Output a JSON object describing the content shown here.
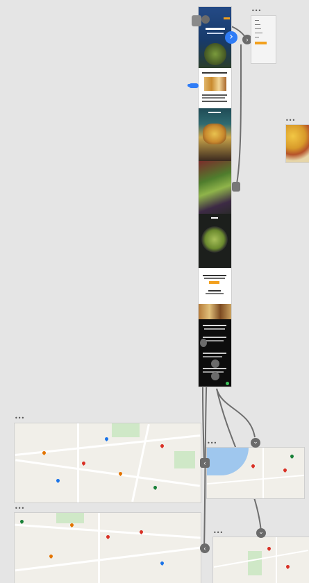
{
  "canvas": {
    "background": "#e5e5e5",
    "frame_menu_icon": "more-dots-icon"
  },
  "main_page": {
    "hero_heading": "",
    "section_headings": [
      "",
      "",
      ""
    ],
    "cta_button": ""
  },
  "side_menu": {
    "items": [
      "",
      "",
      "",
      "",
      ""
    ],
    "button_label": ""
  },
  "connectors": {
    "arrow_right": "›",
    "arrow_left": "‹",
    "arrow_down": "⌄"
  },
  "colors": {
    "accent_blue": "#2f7cf6",
    "connector_gray": "#6b6b6b",
    "orange_button": "#f2a01e",
    "map_pin_red": "#d93025"
  }
}
